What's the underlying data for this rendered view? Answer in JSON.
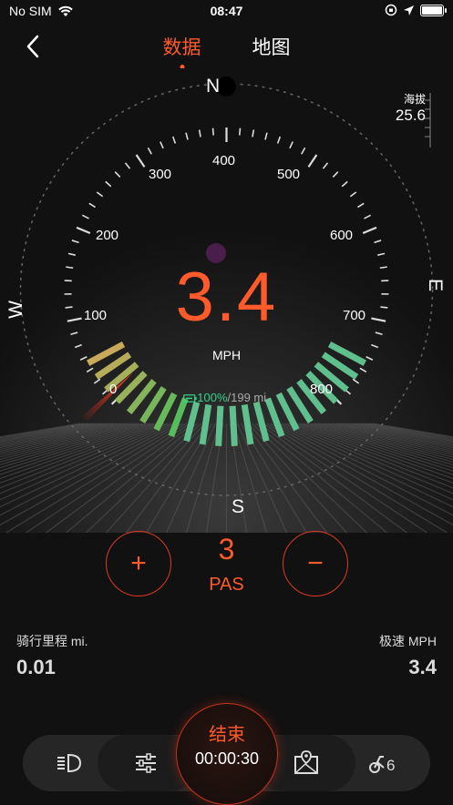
{
  "status_bar": {
    "carrier": "No SIM",
    "time": "08:47"
  },
  "nav": {
    "tabs": [
      {
        "label": "数据",
        "active": true
      },
      {
        "label": "地图",
        "active": false
      }
    ]
  },
  "compass": {
    "north": "N",
    "east": "E",
    "south": "S",
    "west": "W"
  },
  "altitude": {
    "label": "海拔",
    "value": "25.6"
  },
  "gauge": {
    "ticks": [
      "0",
      "100",
      "200",
      "300",
      "400",
      "500",
      "600",
      "700",
      "800"
    ],
    "speed": "3.4",
    "unit": "MPH",
    "battery_percent": "100%",
    "battery_range": "/199 mi."
  },
  "pas": {
    "plus_label": "+",
    "minus_label": "−",
    "value": "3",
    "label": "PAS"
  },
  "stats": {
    "distance_label": "骑行里程 mi.",
    "distance_value": "0.01",
    "top_speed_label": "极速 MPH",
    "top_speed_value": "3.4"
  },
  "bottom_bar": {
    "end_label": "结束",
    "timer": "00:00:30",
    "bike_badge": "6"
  },
  "colors": {
    "accent": "#ff5a2b",
    "battery_green": "#35d188"
  }
}
